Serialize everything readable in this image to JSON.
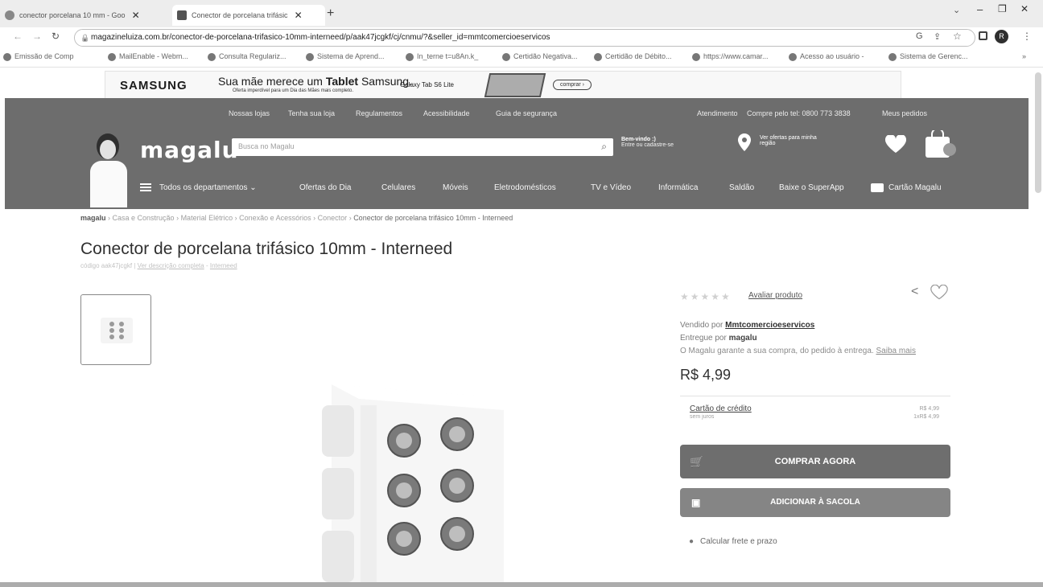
{
  "tabs": [
    {
      "title": "conector porcelana 10 mm - Goo"
    },
    {
      "title": "Conector de porcelana trifásic"
    }
  ],
  "address": {
    "url": "magazineluiza.com.br/conector-de-porcelana-trifasico-10mm-interneed/p/aak47jcgkf/cj/cnmu/?&seller_id=mmtcomercioeservicos"
  },
  "bookmarks": [
    "Emissão de Comp",
    "MailEnable - Webm...",
    "Consulta Regulariz...",
    "Sistema de Aprend...",
    "In_terne t=u8An.k_",
    "Certidão Negativa...",
    "Certidão de Débito...",
    "https://www.camar...",
    "Acesso ao usuário -",
    "Sistema de Gerenc..."
  ],
  "ad": {
    "brand": "SAMSUNG",
    "headline_pre": "Sua mãe merece um",
    "headline_bold": "Tablet",
    "headline_post": "Samsung.",
    "subline": "Oferta imperdível para um Dia das Mães mais completo.",
    "product": "Galaxy Tab S6 Lite",
    "cta": "comprar"
  },
  "header": {
    "links": [
      "Nossas lojas",
      "Tenha sua loja",
      "Regulamentos",
      "Acessibilidade",
      "Guia de segurança"
    ],
    "right_links": [
      "Atendimento",
      "Compre pelo tel: 0800 773 3838",
      "Meus pedidos"
    ],
    "logo": "magalu",
    "search_placeholder": "Busca no Magalu",
    "welcome": "Bem-vindo :)",
    "welcome_sub": "Entre ou cadastre-se",
    "location": "Ver ofertas para minha",
    "location_sub": "região",
    "nav": [
      "Todos os departamentos",
      "Ofertas do Dia",
      "Celulares",
      "Móveis",
      "Eletrodomésticos",
      "TV e Vídeo",
      "Informática",
      "Saldão",
      "Baixe o SuperApp",
      "Cartão Magalu"
    ]
  },
  "breadcrumb": {
    "home": "magalu",
    "items": [
      "Casa e Construção",
      "Material Elétrico",
      "Conexão e Acessórios",
      "Conector",
      "Conector de porcelana trifásico 10mm - Interneed"
    ]
  },
  "product": {
    "title": "Conector de porcelana trifásico 10mm - Interneed",
    "code_text": "código aak47jcgkf |",
    "full_desc_link": "Ver descrição completa",
    "brand_link": "Interneed",
    "rating_stars": 0,
    "rate_link": "Avaliar produto",
    "seller_prefix": "Vendido por",
    "seller": "Mmtcomercioeservicos",
    "delivered_prefix": "Entregue por",
    "delivered_by": "magalu",
    "guarantee": "O Magalu garante a sua compra, do pedido à entrega.",
    "guarantee_link": "Saiba mais",
    "price": "R$ 4,99",
    "payment_method": "Cartão de crédito",
    "payment_sub": "sem juros",
    "payment_price": "R$ 4,99",
    "payment_installments": "1xR$ 4,99",
    "buy_now": "COMPRAR AGORA",
    "add_bag": "ADICIONAR À SACOLA",
    "shipping": "Calcular frete e prazo"
  }
}
